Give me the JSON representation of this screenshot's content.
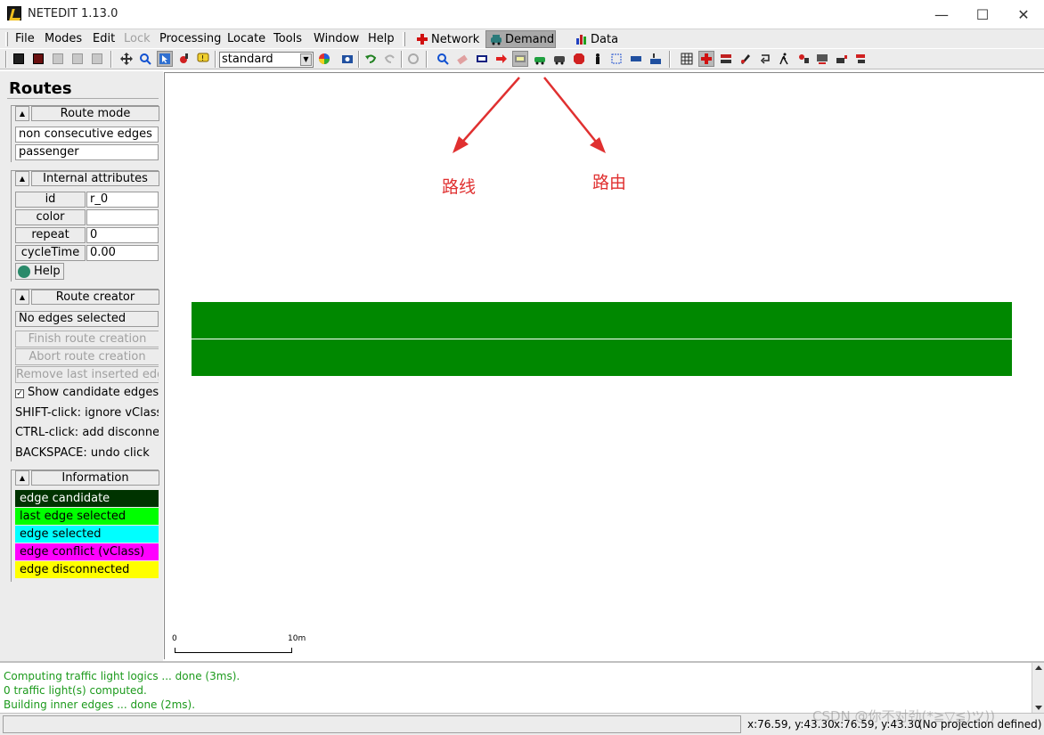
{
  "window": {
    "title": "NETEDIT 1.13.0",
    "minimize": "—",
    "maximize": "☐",
    "close": "✕"
  },
  "menu": {
    "items": [
      "File",
      "Modes",
      "Edit",
      "Lock",
      "Processing",
      "Locate",
      "Tools",
      "Window",
      "Help"
    ],
    "supermodes": [
      "Network",
      "Demand",
      "Data"
    ],
    "active_supermode": "Demand"
  },
  "toolbar": {
    "scheme": "standard"
  },
  "left_panel": {
    "title": "Routes",
    "route_mode": {
      "header": "Route mode",
      "mode_value": "non consecutive edges",
      "vclass_value": "passenger"
    },
    "internal_attributes": {
      "header": "Internal attributes",
      "rows": [
        {
          "name": "id",
          "value": "r_0"
        },
        {
          "name": "color",
          "value": ""
        },
        {
          "name": "repeat",
          "value": "0"
        },
        {
          "name": "cycleTime",
          "value": "0.00"
        }
      ],
      "help": "Help"
    },
    "route_creator": {
      "header": "Route creator",
      "status": "No edges selected",
      "finish": "Finish route creation",
      "abort": "Abort route creation",
      "remove_last": "Remove last inserted edge",
      "show_candidates": "Show candidate edges",
      "hint_shift": "SHIFT-click: ignore vClass",
      "hint_ctrl": "CTRL-click: add disconnected",
      "hint_backspace": "BACKSPACE: undo click"
    },
    "information": {
      "header": "Information",
      "legend": [
        {
          "label": "edge candidate",
          "bg": "#003300",
          "fg": "#ffffff"
        },
        {
          "label": "last edge selected",
          "bg": "#00ff00",
          "fg": "#000000"
        },
        {
          "label": "edge selected",
          "bg": "#00ffff",
          "fg": "#000000"
        },
        {
          "label": "edge conflict (vClass)",
          "bg": "#ff00ff",
          "fg": "#000000"
        },
        {
          "label": "edge disconnected",
          "bg": "#ffff00",
          "fg": "#000000"
        }
      ]
    }
  },
  "canvas": {
    "scale_start": "0",
    "scale_end": "10m",
    "annotation_left": "路线",
    "annotation_right": "路由",
    "lane_color": "#008800"
  },
  "messages": [
    "Computing traffic light logics ... done (3ms).",
    " 0 traffic light(s) computed.",
    "Building inner edges ... done (2ms)."
  ],
  "status": {
    "coord1": "x:76.59, y:43.30",
    "coord2": "x:76.59, y:43.30",
    "projection": "(No projection defined)",
    "watermark": "CSDN @你不对劲(*≧▽≦)ツ))"
  }
}
